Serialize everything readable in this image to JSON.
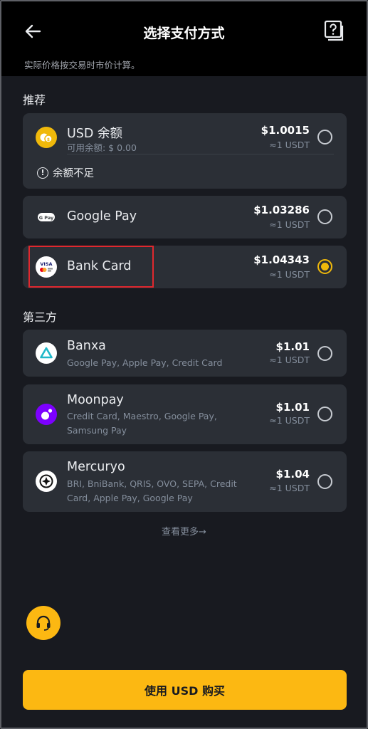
{
  "header": {
    "title": "选择支付方式",
    "subtitle": "实际价格按交易时市价计算。"
  },
  "sections": {
    "recommended": "推荐",
    "third_party": "第三方"
  },
  "methods": [
    {
      "name": "USD 余额",
      "desc": "可用余额: $ 0.00",
      "price": "$1.0015",
      "approx": "≈1 USDT",
      "warning": "余额不足",
      "icon": "coins-icon",
      "selected": false
    },
    {
      "name": "Google Pay",
      "desc": "",
      "price": "$1.03286",
      "approx": "≈1 USDT",
      "icon": "google-pay-icon",
      "icon_text": "G Pay",
      "selected": false
    },
    {
      "name": "Bank Card",
      "desc": "",
      "price": "$1.04343",
      "approx": "≈1 USDT",
      "icon": "visa-mastercard-icon",
      "icon_text": "VISA",
      "selected": true
    },
    {
      "name": "Banxa",
      "desc": "Google Pay, Apple Pay, Credit Card",
      "price": "$1.01",
      "approx": "≈1 USDT",
      "icon": "banxa-logo-icon",
      "selected": false
    },
    {
      "name": "Moonpay",
      "desc": "Credit Card, Maestro, Google Pay, Samsung Pay",
      "price": "$1.01",
      "approx": "≈1 USDT",
      "icon": "moonpay-logo-icon",
      "selected": false
    },
    {
      "name": "Mercuryo",
      "desc": "BRI, BniBank, QRIS, OVO, SEPA, Credit Card, Apple Pay, Google Pay",
      "price": "$1.04",
      "approx": "≈1 USDT",
      "icon": "mercuryo-logo-icon",
      "selected": false
    }
  ],
  "more_link": "查看更多→",
  "buy_button": "使用 USD 购买",
  "colors": {
    "accent": "#fcb812",
    "card_bg": "#2b2f36",
    "page_bg": "#181a20",
    "highlight": "#e0282e"
  }
}
